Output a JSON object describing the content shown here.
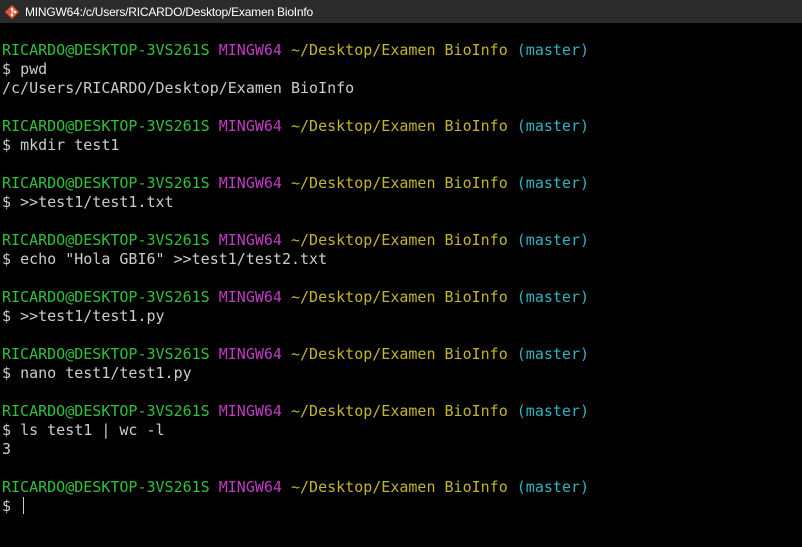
{
  "window": {
    "title": "MINGW64:/c/Users/RICARDO/Desktop/Examen BioInfo"
  },
  "prompt": {
    "user_host": "RICARDO@DESKTOP-3VS261S",
    "system": "MINGW64",
    "path": "~/Desktop/Examen BioInfo",
    "branch": "(master)",
    "symbol": "$"
  },
  "terminal": {
    "blocks": [
      {
        "command": "pwd",
        "output": "/c/Users/RICARDO/Desktop/Examen BioInfo"
      },
      {
        "command": "mkdir test1",
        "output": ""
      },
      {
        "command": ">>test1/test1.txt",
        "output": ""
      },
      {
        "command": "echo \"Hola GBI6\" >>test1/test2.txt",
        "output": ""
      },
      {
        "command": ">>test1/test1.py",
        "output": ""
      },
      {
        "command": "nano test1/test1.py",
        "output": ""
      },
      {
        "command": "ls test1 | wc -l",
        "output": "3"
      },
      {
        "command": "",
        "output": ""
      }
    ]
  },
  "colors": {
    "user_host": "#2ec23b",
    "system": "#c33ac3",
    "path": "#c1b42e",
    "branch": "#2fb3c3",
    "text": "#cccccc",
    "background": "#000000",
    "titlebar": "#2b2b2b"
  },
  "icons": {
    "app": "git-bash-icon"
  }
}
